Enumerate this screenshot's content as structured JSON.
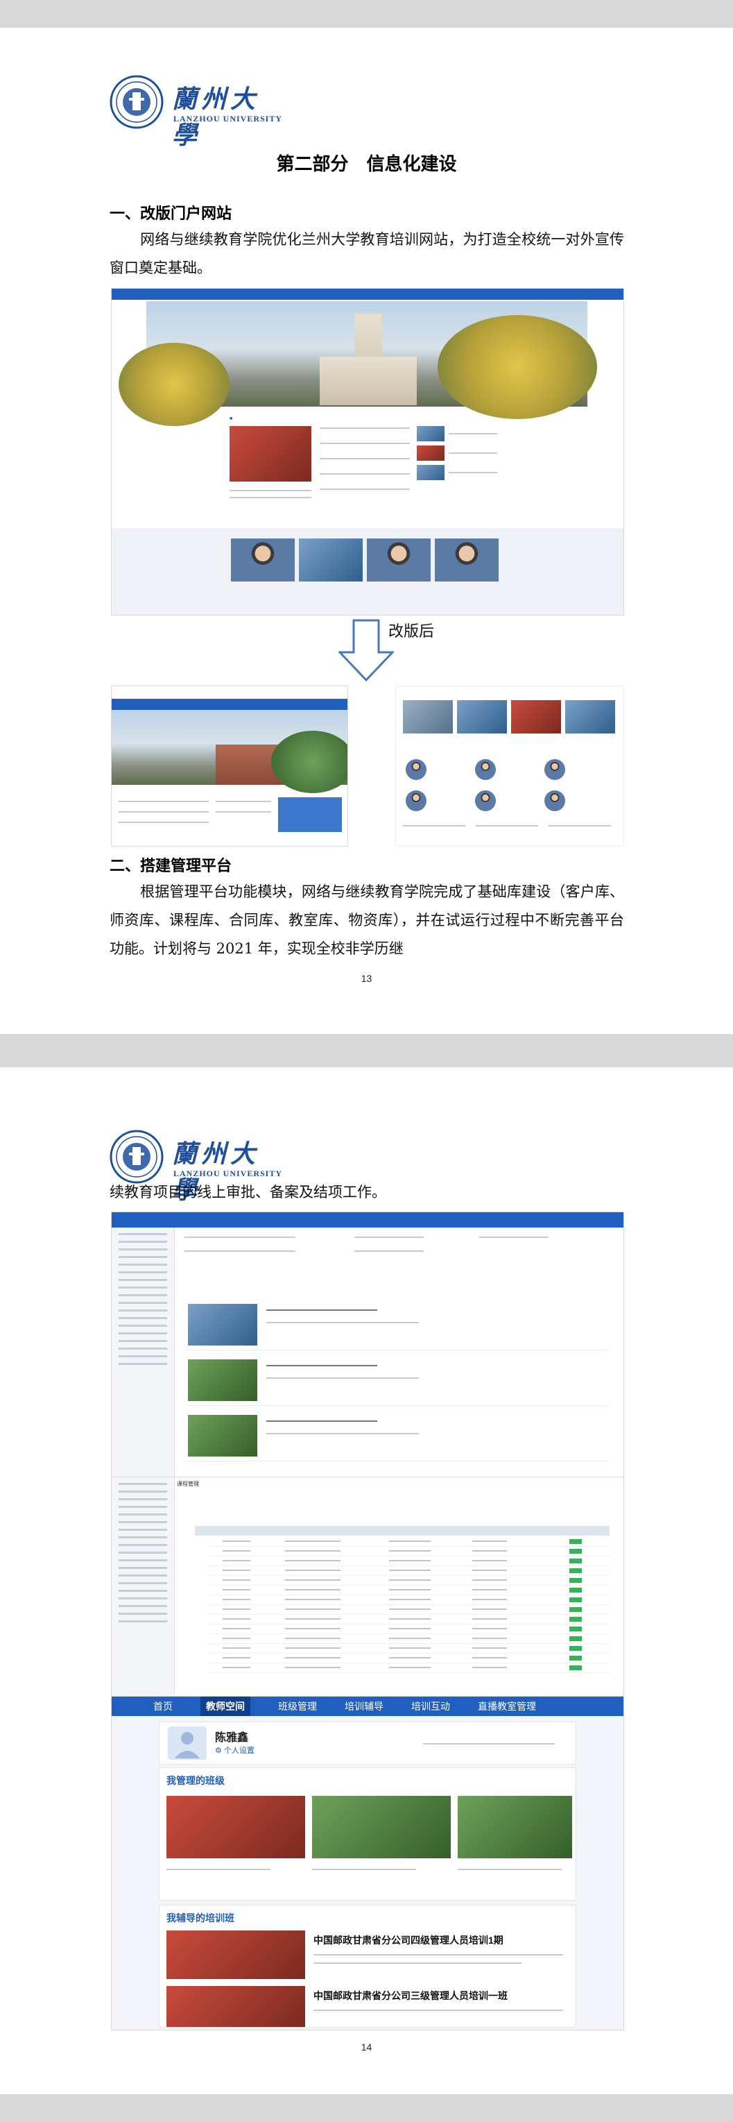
{
  "page1": {
    "logo": {
      "name_cn": "蘭州大學",
      "name_en": "LANZHOU UNIVERSITY"
    },
    "heading": "第二部分　信息化建设",
    "section1": {
      "title": "一、改版门户网站",
      "text": "网络与继续教育学院优化兰州大学教育培训网站，为打造全校统一对外宣传窗口奠定基础。"
    },
    "caption_after": "改版后",
    "section2": {
      "title": "二、搭建管理平台",
      "text": "根据管理平台功能模块，网络与继续教育学院完成了基础库建设（客户库、师资库、课程库、合同库、教室库、物资库），并在试运行过程中不断完善平台功能。计划将与 2021 年，实现全校非学历继"
    },
    "page_number": "13"
  },
  "page2": {
    "logo": {
      "name_cn": "蘭州大學",
      "name_en": "LANZHOU UNIVERSITY"
    },
    "text": "续教育项目的线上审批、备案及结项工作。",
    "admin": {
      "menu_label": "课程管理"
    },
    "platform": {
      "tabs": [
        "首页",
        "教师空间",
        "班级管理",
        "培训辅导",
        "培训互动",
        "直播教室管理"
      ],
      "active_tab": "教师空间",
      "user_name": "陈雅鑫",
      "user_link": "个人设置",
      "my_classes": "我管理的班级",
      "my_training": "我辅导的培训班",
      "course1": "中国邮政甘肃省分公司四级管理人员培训1期",
      "course2": "中国邮政甘肃省分公司三级管理人员培训一班"
    },
    "page_number": "14"
  }
}
